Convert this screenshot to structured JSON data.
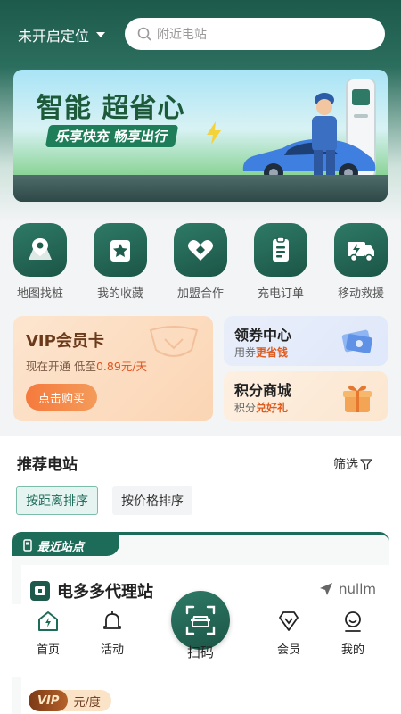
{
  "header": {
    "location": "未开启定位",
    "search_placeholder": "附近电站"
  },
  "banner": {
    "title": "智能 超省心",
    "subtitle": "乐享快充 畅享出行"
  },
  "quick_actions": [
    {
      "label": "地图找桩",
      "icon": "map-pin-icon"
    },
    {
      "label": "我的收藏",
      "icon": "star-icon"
    },
    {
      "label": "加盟合作",
      "icon": "handshake-heart-icon"
    },
    {
      "label": "充电订单",
      "icon": "order-list-icon"
    },
    {
      "label": "移动救援",
      "icon": "rescue-truck-icon"
    }
  ],
  "vip": {
    "title": "VIP会员卡",
    "desc_prefix": "现在开通 低至",
    "desc_price": "0.89元/天",
    "button": "点击购买"
  },
  "coupon": {
    "title": "领券中心",
    "desc_prefix": "用券",
    "desc_highlight": "更省钱"
  },
  "points": {
    "title": "积分商城",
    "desc_prefix": "积分",
    "desc_highlight": "兑好礼"
  },
  "recommend": {
    "title": "推荐电站",
    "filter": "筛选",
    "sort_distance": "按距离排序",
    "sort_price": "按价格排序"
  },
  "station": {
    "tag": "最近站点",
    "name": "电多多代理站",
    "distance": "nullm",
    "vip_label": "VIP",
    "unit": "元/度"
  },
  "tabbar": {
    "home": "首页",
    "activity": "活动",
    "scan": "扫码",
    "member": "会员",
    "mine": "我的"
  },
  "colors": {
    "primary": "#1d6b59",
    "accent_orange": "#f57a3c"
  }
}
